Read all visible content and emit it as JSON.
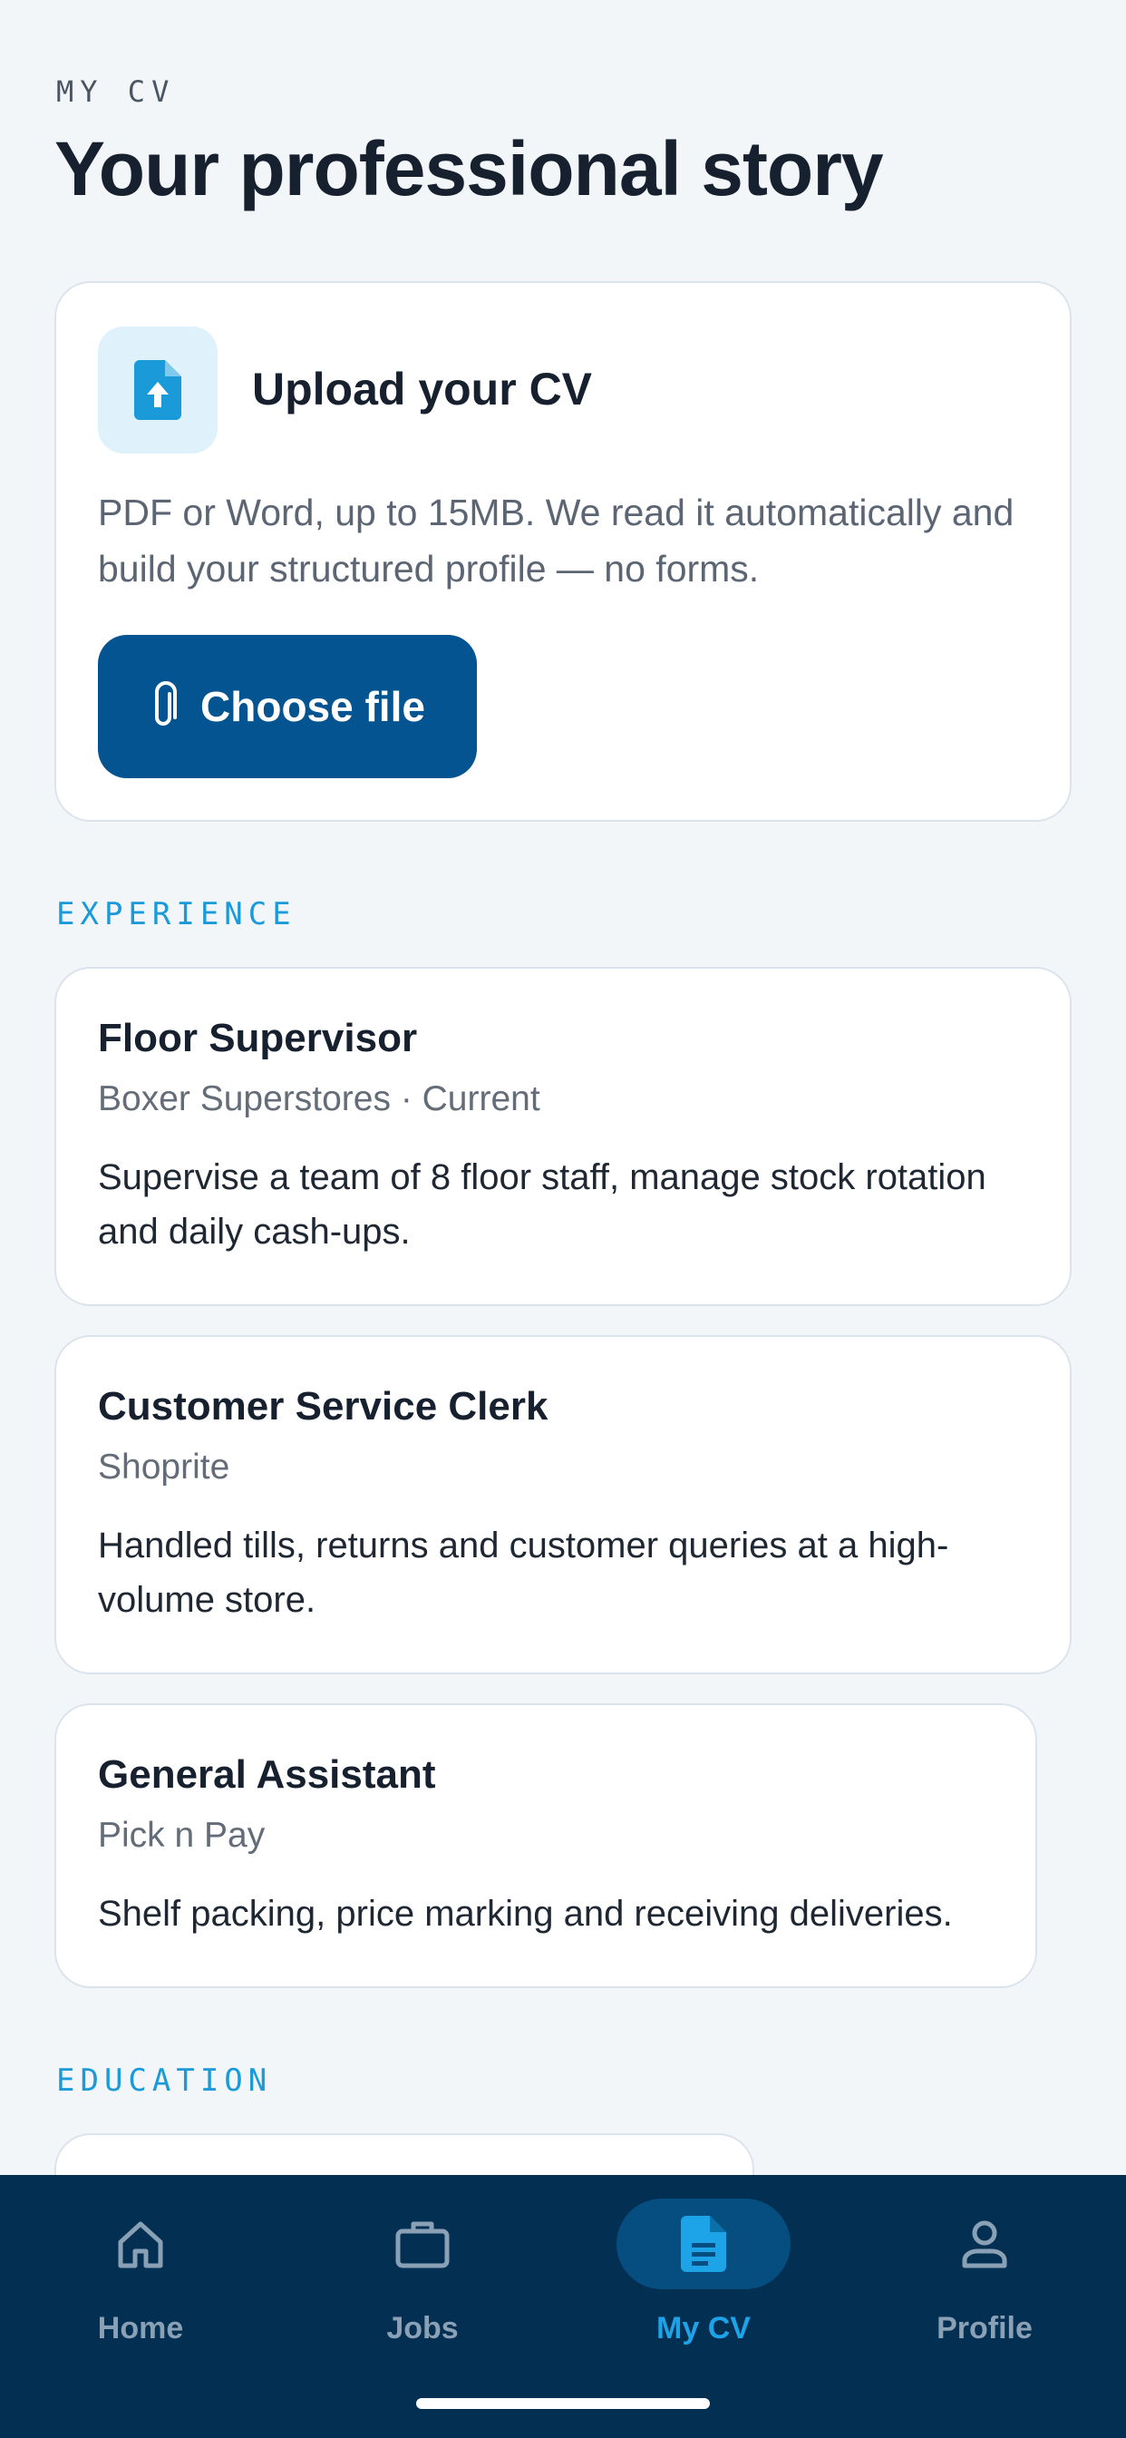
{
  "header": {
    "eyebrow": "MY CV",
    "title": "Your professional story"
  },
  "upload": {
    "icon": "file-upload-icon",
    "title": "Upload your CV",
    "description": "PDF or Word, up to 15MB. We read it automatically and build your structured profile — no forms.",
    "button_icon": "paperclip-icon",
    "button_label": "Choose file"
  },
  "experience": {
    "label": "EXPERIENCE",
    "items": [
      {
        "role": "Floor Supervisor",
        "company": "Boxer Superstores · Current",
        "description": "Supervise a team of 8 floor staff, manage stock rotation and daily cash-ups."
      },
      {
        "role": "Customer Service Clerk",
        "company": "Shoprite",
        "description": "Handled tills, returns and customer queries at a high-volume store."
      },
      {
        "role": "General Assistant",
        "company": "Pick n Pay",
        "description": "Shelf packing, price marking and receiving deliveries."
      }
    ]
  },
  "education": {
    "label": "EDUCATION"
  },
  "nav": {
    "items": [
      {
        "label": "Home",
        "icon": "home-icon"
      },
      {
        "label": "Jobs",
        "icon": "briefcase-icon"
      },
      {
        "label": "My CV",
        "icon": "document-icon",
        "active": true
      },
      {
        "label": "Profile",
        "icon": "person-icon"
      }
    ]
  },
  "colors": {
    "background": "#f3f6f9",
    "primary": "#035491",
    "accent": "#1a9ad9",
    "nav_background": "#032f52",
    "nav_active": "#1ca3e8",
    "nav_inactive": "#8aa1b5"
  }
}
